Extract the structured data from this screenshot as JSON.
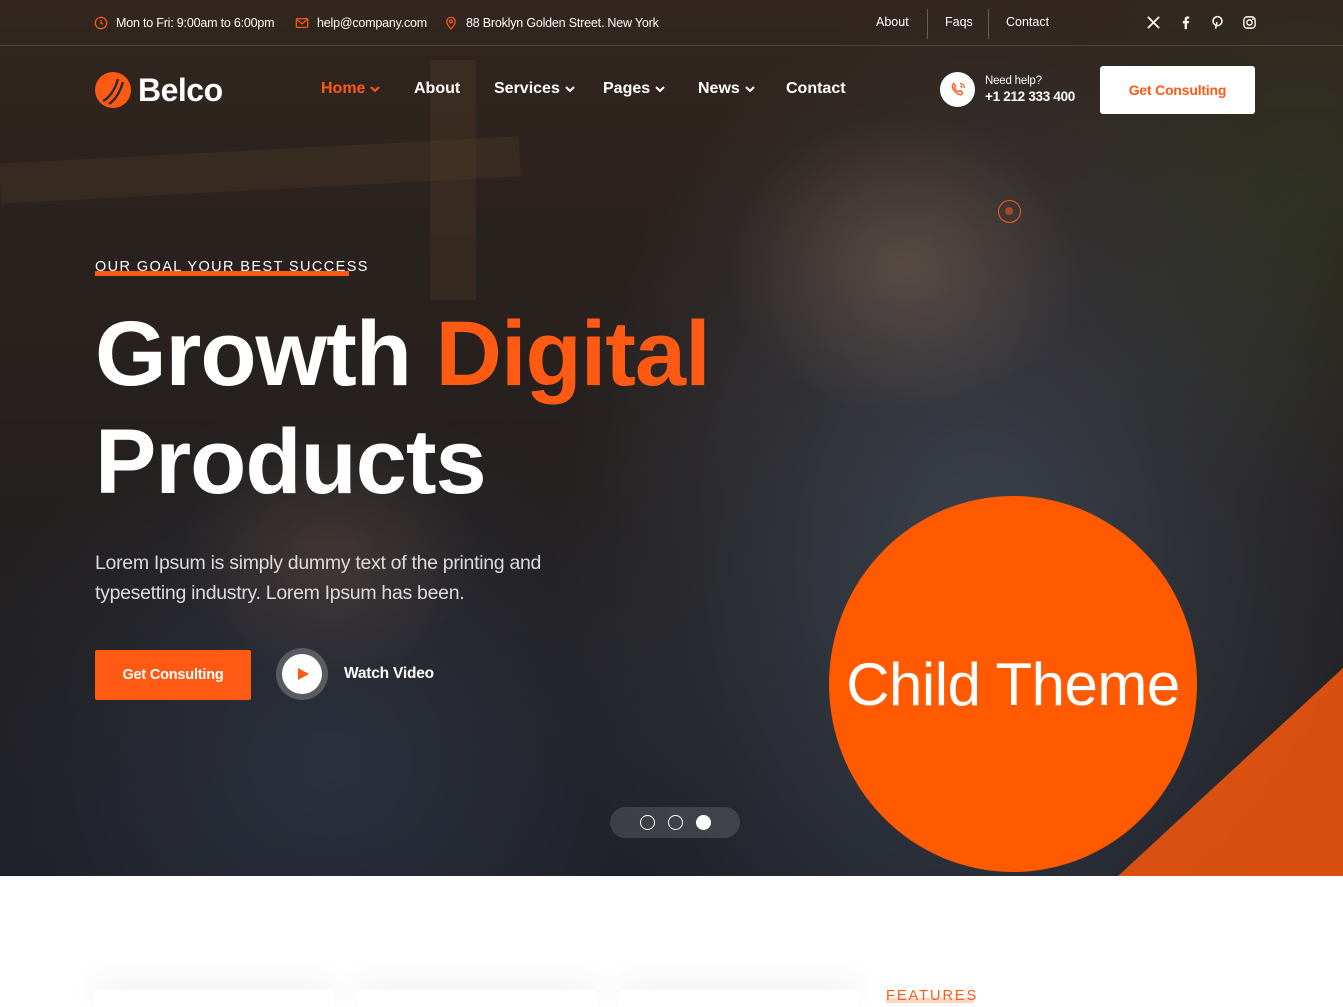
{
  "colors": {
    "accent": "#ff5a14",
    "badge": "#ff5a00",
    "white": "#ffffff"
  },
  "topbar": {
    "hours": "Mon to Fri: 9:00am to 6:00pm",
    "email": "help@company.com",
    "address": "88 Broklyn Golden Street. New York",
    "links": [
      "About",
      "Faqs",
      "Contact"
    ],
    "social_icons": [
      "x-icon",
      "facebook-icon",
      "pinterest-icon",
      "instagram-icon"
    ]
  },
  "header": {
    "logo": "Belco",
    "nav": [
      {
        "label": "Home",
        "dropdown": true,
        "active": true
      },
      {
        "label": "About",
        "dropdown": false,
        "active": false
      },
      {
        "label": "Services",
        "dropdown": true,
        "active": false
      },
      {
        "label": "Pages",
        "dropdown": true,
        "active": false
      },
      {
        "label": "News",
        "dropdown": true,
        "active": false
      },
      {
        "label": "Contact",
        "dropdown": false,
        "active": false
      }
    ],
    "help_label": "Need help?",
    "help_phone": "+1 212 333 400",
    "cta": "Get Consulting"
  },
  "hero": {
    "eyebrow": "OUR GOAL YOUR BEST SUCCESS",
    "title_part1": "Growth ",
    "title_accent": "Digital",
    "title_line2": "Products",
    "lead": "Lorem Ipsum is simply dummy text of the printing and typesetting industry. Lorem Ipsum has been.",
    "cta": "Get Consulting",
    "video_label": "Watch Video",
    "slides": 3,
    "active_slide": 3,
    "badge": "Child Theme"
  },
  "below": {
    "features_label": "FEATURES"
  }
}
